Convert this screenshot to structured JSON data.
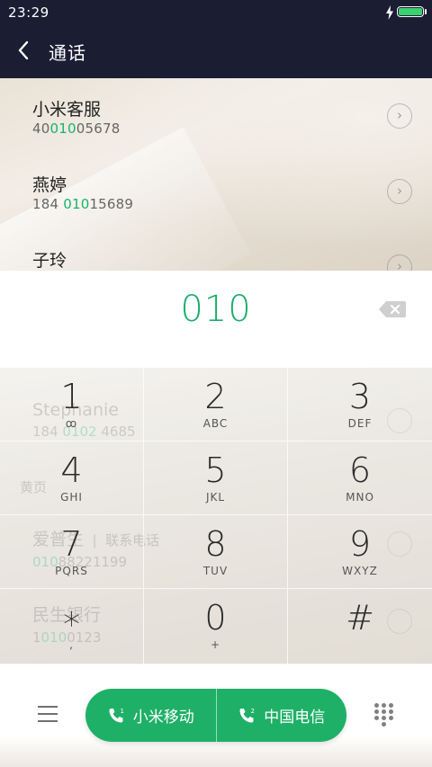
{
  "status_bar": {
    "time": "23:29",
    "charging_icon": "bolt-icon",
    "battery_icon": "battery-icon"
  },
  "header": {
    "title": "通话",
    "back_icon": "chevron-left-icon"
  },
  "results": [
    {
      "name": "小米客服",
      "number_pre": "40",
      "number_match": "010",
      "number_post": "05678"
    },
    {
      "name": "燕婷",
      "number_pre": "184 ",
      "number_match": "010",
      "number_post": "15689"
    },
    {
      "name": "子玲",
      "number_pre": "",
      "number_match": "",
      "number_post": ""
    }
  ],
  "input": {
    "dialed": "010",
    "backspace_icon": "backspace-icon"
  },
  "ghost_list": [
    {
      "name": "Stephanie",
      "number_pre": "184 ",
      "number_match": "0102",
      "number_post": " 4685"
    },
    {
      "name": "黄页",
      "number_pre": "",
      "number_match": "",
      "number_post": ""
    },
    {
      "name": "爱普生",
      "suffix": "联系电话",
      "number_pre": "",
      "number_match": "010",
      "number_post": "88221199"
    },
    {
      "name": "民生银行",
      "number_pre": "1",
      "number_match": "010",
      "number_post": "0123"
    }
  ],
  "keypad": [
    {
      "digit": "1",
      "letters": "ꝏ"
    },
    {
      "digit": "2",
      "letters": "ABC"
    },
    {
      "digit": "3",
      "letters": "DEF"
    },
    {
      "digit": "4",
      "letters": "GHI"
    },
    {
      "digit": "5",
      "letters": "JKL"
    },
    {
      "digit": "6",
      "letters": "MNO"
    },
    {
      "digit": "7",
      "letters": "PQRS"
    },
    {
      "digit": "8",
      "letters": "TUV"
    },
    {
      "digit": "9",
      "letters": "WXYZ"
    },
    {
      "digit": "∗",
      "letters": ","
    },
    {
      "digit": "0",
      "letters": "+"
    },
    {
      "digit": "#",
      "letters": ""
    }
  ],
  "bottom": {
    "call_sim1": {
      "label": "小米移动",
      "sim": "1"
    },
    "call_sim2": {
      "label": "中国电信",
      "sim": "2"
    },
    "menu_icon": "menu-icon",
    "dialpad_icon": "dialpad-icon"
  },
  "colors": {
    "accent": "#1fb067",
    "header_bg": "#1b1d33",
    "match": "#18b36b"
  }
}
